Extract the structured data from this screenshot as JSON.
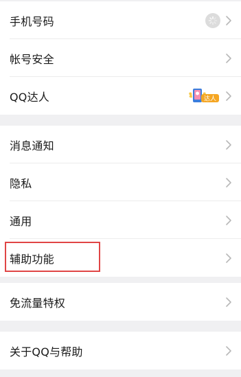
{
  "settings": {
    "group1": [
      {
        "label": "手机号码"
      },
      {
        "label": "帐号安全"
      },
      {
        "label": "QQ达人",
        "badge_text": "达人"
      }
    ],
    "group2": [
      {
        "label": "消息通知"
      },
      {
        "label": "隐私"
      },
      {
        "label": "通用"
      },
      {
        "label": "辅助功能"
      }
    ],
    "group3": [
      {
        "label": "免流量特权"
      }
    ],
    "group4": [
      {
        "label": "关于QQ与帮助"
      }
    ]
  },
  "colors": {
    "highlight": "#e04545",
    "background": "#f0f0f2",
    "badge_orange": "#f5a623"
  },
  "icons": {
    "chevron": "chevron-right-icon",
    "loading": "loading-spinner-icon",
    "qq_badge": "qq-expert-badge-icon"
  }
}
